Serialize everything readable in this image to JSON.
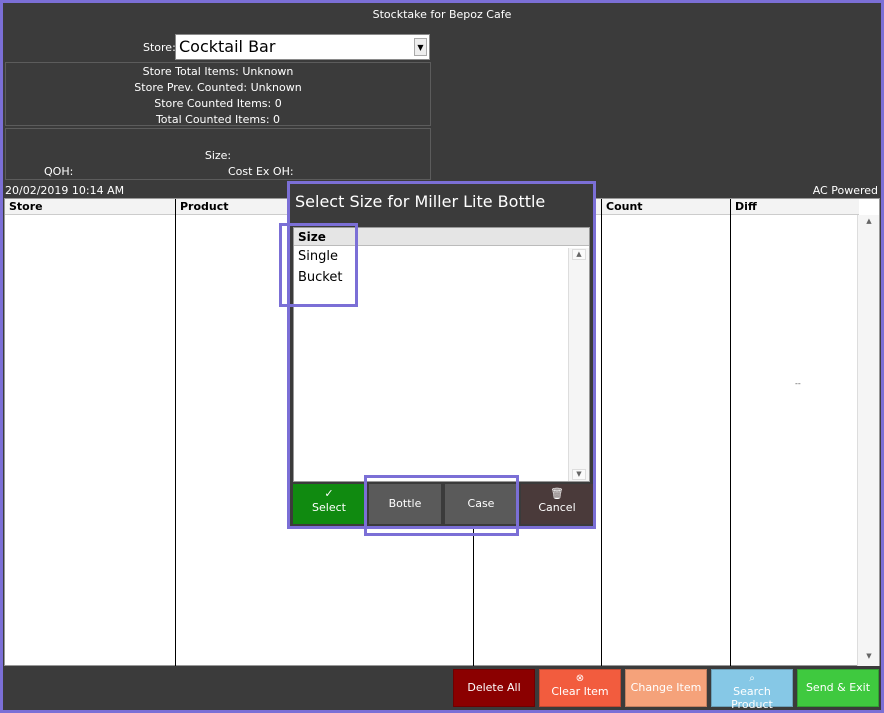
{
  "window": {
    "title": "Stocktake for Bepoz Cafe"
  },
  "store": {
    "label": "Store:",
    "selected": "Cocktail Bar"
  },
  "info": {
    "total_items": "Store Total Items: Unknown",
    "prev_counted": "Store Prev. Counted: Unknown",
    "store_counted": "Store Counted Items: 0",
    "total_counted": "Total Counted Items: 0",
    "size": "Size:",
    "qoh": "QOH:",
    "cost_ex": "Cost Ex OH:"
  },
  "status": {
    "datetime": "20/02/2019 10:14 AM",
    "power": "AC Powered"
  },
  "grid": {
    "columns": [
      "Store",
      "Product",
      "",
      "Count",
      "Diff"
    ],
    "marker": "--"
  },
  "dialog": {
    "title": "Select Size for Miller Lite Bottle",
    "list_header": "Size",
    "items": [
      "Single",
      "Bucket"
    ],
    "buttons": {
      "select": "Select",
      "bottle": "Bottle",
      "case": "Case",
      "cancel": "Cancel"
    }
  },
  "actions": {
    "delete_all": "Delete All",
    "clear_item": "Clear Item",
    "change_item": "Change Item",
    "search_product": "Search Product",
    "send_exit": "Send & Exit"
  },
  "colors": {
    "background": "#3b3b3b",
    "highlight": "#7b6fd6",
    "delete": "#8b0000",
    "clear": "#f25c3e",
    "change": "#f5a27a",
    "search": "#86c8e6",
    "send": "#3fc93f",
    "select": "#108a10",
    "cancel": "#4a3a3a"
  }
}
